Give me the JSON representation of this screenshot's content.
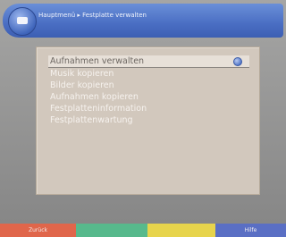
{
  "header": {
    "title": "Hauptmenü ▸ Festplatte verwalten",
    "icon": "tv-icon"
  },
  "menu": {
    "items": [
      {
        "label": "Aufnahmen verwalten",
        "selected": true
      },
      {
        "label": "Musik kopieren"
      },
      {
        "label": "Bilder kopieren"
      },
      {
        "label": "Aufnahmen kopieren"
      },
      {
        "label": "Festplatteninformation"
      },
      {
        "label": "Festplattenwartung"
      }
    ]
  },
  "footer": {
    "red_label": "Zurück",
    "green_label": "",
    "yellow_label": "",
    "blue_label": "Hilfe"
  },
  "colors": {
    "accent": "#4a6ec3",
    "red": "#e0664b",
    "green": "#57b98c",
    "yellow": "#e7d44c",
    "blue": "#5a6fc4"
  }
}
